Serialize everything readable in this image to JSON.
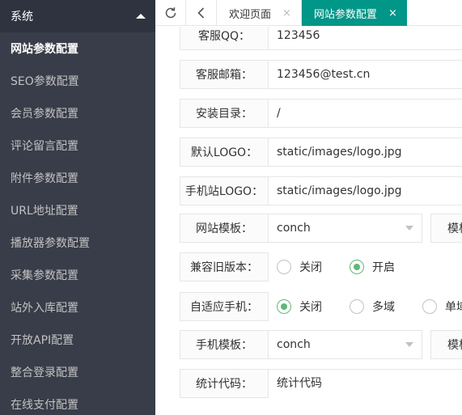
{
  "sidebar": {
    "header": "系统",
    "items": [
      {
        "label": "网站参数配置",
        "active": true
      },
      {
        "label": "SEO参数配置"
      },
      {
        "label": "会员参数配置"
      },
      {
        "label": "评论留言配置"
      },
      {
        "label": "附件参数配置"
      },
      {
        "label": "URL地址配置"
      },
      {
        "label": "播放器参数配置"
      },
      {
        "label": "采集参数配置"
      },
      {
        "label": "站外入库配置"
      },
      {
        "label": "开放API配置"
      },
      {
        "label": "整合登录配置"
      },
      {
        "label": "在线支付配置"
      }
    ]
  },
  "tabs": [
    {
      "label": "欢迎页面",
      "close": "×"
    },
    {
      "label": "网站参数配置",
      "close": "×",
      "active": true
    }
  ],
  "form": {
    "qq": {
      "label": "客服QQ：",
      "value": "123456"
    },
    "email": {
      "label": "客服邮箱：",
      "value": "123456@test.cn"
    },
    "install_dir": {
      "label": "安装目录：",
      "value": "/"
    },
    "logo": {
      "label": "默认LOGO：",
      "value": "static/images/logo.jpg"
    },
    "mobile_logo": {
      "label": "手机站LOGO：",
      "value": "static/images/logo.jpg"
    },
    "template": {
      "label": "网站模板：",
      "value": "conch",
      "extra": "模板"
    },
    "compat": {
      "label": "兼容旧版本：",
      "options": [
        "关闭",
        "开启"
      ],
      "selected": 1
    },
    "adaptive": {
      "label": "自适应手机：",
      "options": [
        "关闭",
        "多域",
        "单域"
      ],
      "selected": 0
    },
    "mobile_template": {
      "label": "手机模板：",
      "value": "conch",
      "extra": "模板"
    },
    "stats": {
      "label": "统计代码：",
      "value": "统计代码"
    }
  },
  "colors": {
    "accent": "#009688",
    "radio": "#5fb878",
    "sidebar": "#393d49"
  }
}
